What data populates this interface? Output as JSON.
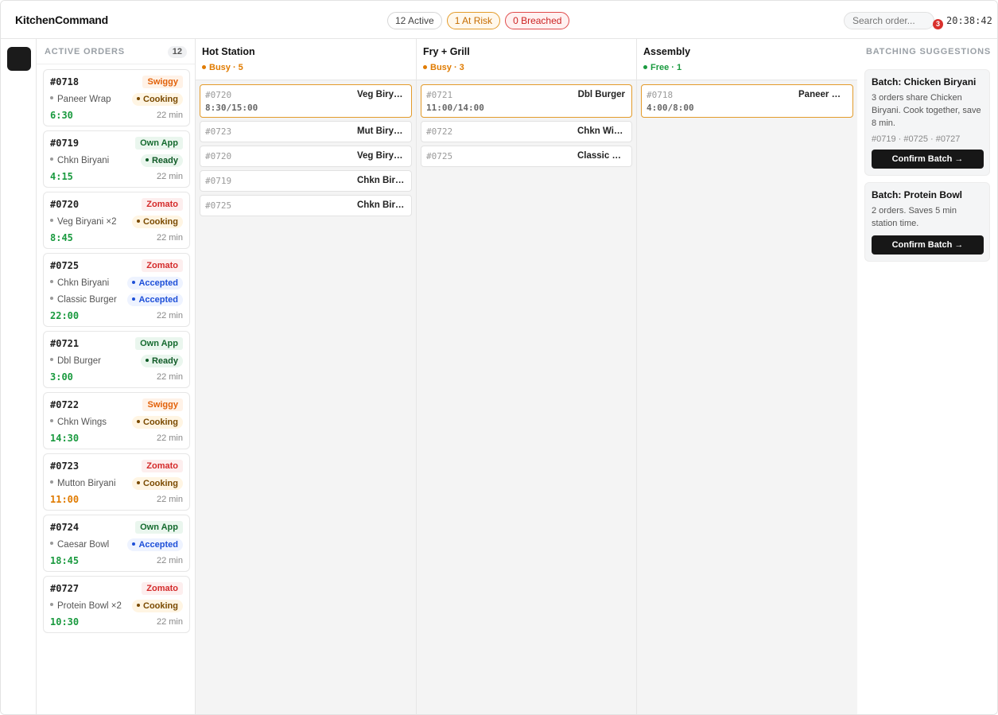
{
  "header": {
    "brand": "KitchenCommand",
    "pills": {
      "active": "12 Active",
      "at_risk": "1 At Risk",
      "breached": "0 Breached"
    },
    "search_placeholder": "Search order...",
    "notification_count": "3",
    "clock": "20:38:42"
  },
  "orders_panel": {
    "title": "ACTIVE ORDERS",
    "count": "12",
    "orders": [
      {
        "id": "#0718",
        "source": "Swiggy",
        "source_kind": "swiggy",
        "items": [
          {
            "name": "Paneer Wrap",
            "status": "Cooking",
            "status_kind": "cooking"
          }
        ],
        "timer": "6:30",
        "timer_state": "ok",
        "eta": "22 min"
      },
      {
        "id": "#0719",
        "source": "Own App",
        "source_kind": "own",
        "items": [
          {
            "name": "Chkn Biryani",
            "status": "Ready",
            "status_kind": "ready"
          }
        ],
        "timer": "4:15",
        "timer_state": "ok",
        "eta": "22 min"
      },
      {
        "id": "#0720",
        "source": "Zomato",
        "source_kind": "zomato",
        "items": [
          {
            "name": "Veg Biryani ×2",
            "status": "Cooking",
            "status_kind": "cooking"
          }
        ],
        "timer": "8:45",
        "timer_state": "ok",
        "eta": "22 min"
      },
      {
        "id": "#0725",
        "source": "Zomato",
        "source_kind": "zomato",
        "items": [
          {
            "name": "Chkn Biryani",
            "status": "Accepted",
            "status_kind": "accepted"
          },
          {
            "name": "Classic Burger",
            "status": "Accepted",
            "status_kind": "accepted"
          }
        ],
        "timer": "22:00",
        "timer_state": "ok",
        "eta": "22 min"
      },
      {
        "id": "#0721",
        "source": "Own App",
        "source_kind": "own",
        "items": [
          {
            "name": "Dbl Burger",
            "status": "Ready",
            "status_kind": "ready"
          }
        ],
        "timer": "3:00",
        "timer_state": "ok",
        "eta": "22 min"
      },
      {
        "id": "#0722",
        "source": "Swiggy",
        "source_kind": "swiggy",
        "items": [
          {
            "name": "Chkn Wings",
            "status": "Cooking",
            "status_kind": "cooking"
          }
        ],
        "timer": "14:30",
        "timer_state": "ok",
        "eta": "22 min"
      },
      {
        "id": "#0723",
        "source": "Zomato",
        "source_kind": "zomato",
        "items": [
          {
            "name": "Mutton Biryani",
            "status": "Cooking",
            "status_kind": "cooking"
          }
        ],
        "timer": "11:00",
        "timer_state": "warn",
        "eta": "22 min"
      },
      {
        "id": "#0724",
        "source": "Own App",
        "source_kind": "own",
        "items": [
          {
            "name": "Caesar Bowl",
            "status": "Accepted",
            "status_kind": "accepted"
          }
        ],
        "timer": "18:45",
        "timer_state": "ok",
        "eta": "22 min"
      },
      {
        "id": "#0727",
        "source": "Zomato",
        "source_kind": "zomato",
        "items": [
          {
            "name": "Protein Bowl ×2",
            "status": "Cooking",
            "status_kind": "cooking"
          }
        ],
        "timer": "10:30",
        "timer_state": "ok",
        "eta": "22 min"
      }
    ]
  },
  "stations": [
    {
      "name": "Hot Station",
      "load": "Busy · 5",
      "load_kind": "busy",
      "tickets": [
        {
          "id": "#0720",
          "item": "Veg Biryani",
          "time": "8:30/15:00",
          "active": true
        },
        {
          "id": "#0723",
          "item": "Mut Biryani",
          "time": "",
          "active": false
        },
        {
          "id": "#0720",
          "item": "Veg Biryani",
          "time": "",
          "active": false
        },
        {
          "id": "#0719",
          "item": "Chkn Biryani",
          "time": "",
          "active": false
        },
        {
          "id": "#0725",
          "item": "Chkn Biryani",
          "time": "",
          "active": false
        }
      ]
    },
    {
      "name": "Fry + Grill",
      "load": "Busy · 3",
      "load_kind": "busy",
      "tickets": [
        {
          "id": "#0721",
          "item": "Dbl Burger",
          "time": "11:00/14:00",
          "active": true
        },
        {
          "id": "#0722",
          "item": "Chkn Wings",
          "time": "",
          "active": false
        },
        {
          "id": "#0725",
          "item": "Classic Burger",
          "time": "",
          "active": false
        }
      ]
    },
    {
      "name": "Assembly",
      "load": "Free · 1",
      "load_kind": "free",
      "tickets": [
        {
          "id": "#0718",
          "item": "Paneer Wrap",
          "time": "4:00/8:00",
          "active": true
        }
      ]
    }
  ],
  "batching": {
    "title": "BATCHING SUGGESTIONS",
    "suggestions": [
      {
        "title": "Batch: Chicken Biryani",
        "desc": "3 orders share Chicken Biryani. Cook together, save 8 min.",
        "orders": "#0719 · #0725 · #0727",
        "button": "Confirm Batch →"
      },
      {
        "title": "Batch: Protein Bowl",
        "desc": "2 orders. Saves 5 min station time.",
        "orders": "",
        "button": "Confirm Batch →"
      }
    ]
  },
  "colors": {
    "accent_dark": "#171717",
    "busy": "#e07b00",
    "free": "#1a9a3f",
    "breach": "#cc2222",
    "accepted": "#1d4fd8"
  }
}
